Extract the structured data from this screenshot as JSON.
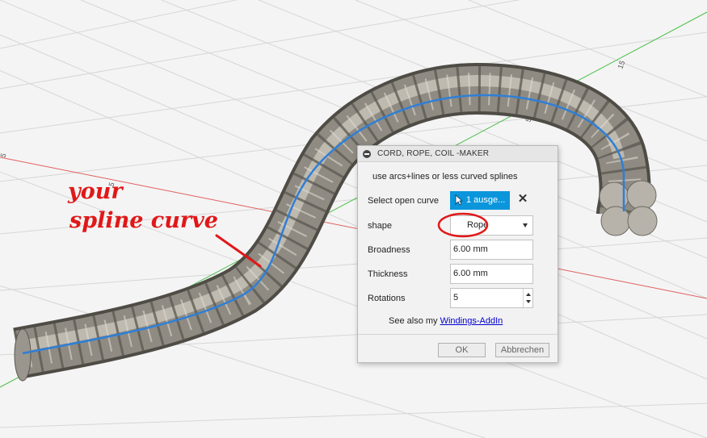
{
  "viewport": {
    "grid_labels": [
      "15",
      "5",
      "5",
      "5"
    ],
    "annotation_text": [
      "your",
      "spline curve"
    ]
  },
  "dialog": {
    "title": "CORD, ROPE, COIL -MAKER",
    "hint": "use arcs+lines or less curved splines",
    "select_label": "Select open curve",
    "select_value": "1 ausge...",
    "shape_label": "shape",
    "shape_value": "Rope",
    "broadness_label": "Broadness",
    "broadness_value": "6.00 mm",
    "thickness_label": "Thickness",
    "thickness_value": "6.00 mm",
    "rotations_label": "Rotations",
    "rotations_value": "5",
    "see_also_prefix": "See also my ",
    "see_also_link": "Windings-AddIn",
    "ok_label": "OK",
    "cancel_label": "Abbrechen"
  },
  "colors": {
    "accent": "#0b96dc",
    "rope": "#8f8b82",
    "spline": "#2f7fd6",
    "annotation": "#e11818",
    "grid_red": "#e06060",
    "grid_green": "#4cbf4c"
  },
  "icons": [
    "collapse-icon",
    "cursor-arrow-icon",
    "clear-x-icon",
    "dropdown-arrow-icon",
    "spinner-icon"
  ]
}
